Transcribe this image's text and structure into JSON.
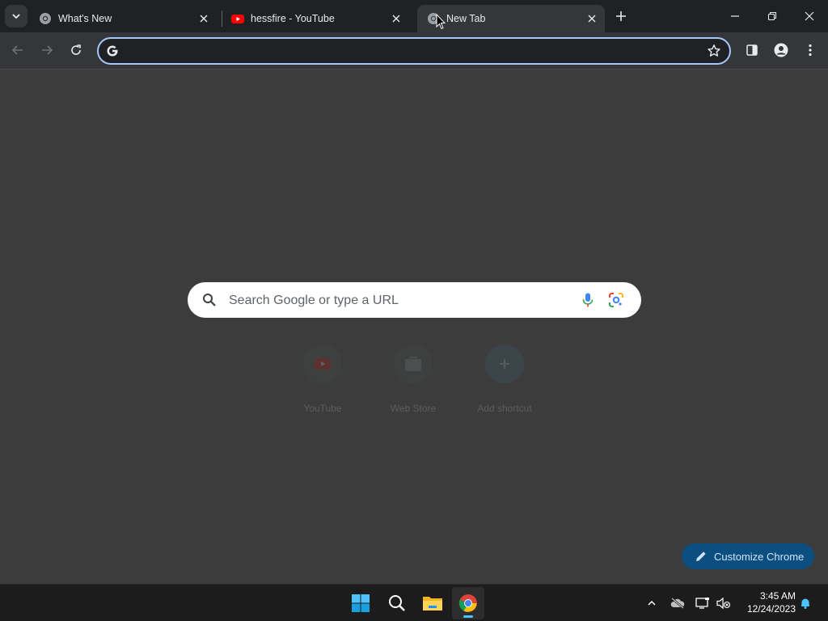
{
  "tabs": [
    {
      "title": "What's New",
      "favicon": "chrome-icon",
      "active": false
    },
    {
      "title": "hessfire - YouTube",
      "favicon": "youtube-icon",
      "active": false
    },
    {
      "title": "New Tab",
      "favicon": "chrome-icon",
      "active": true
    }
  ],
  "omnibox": {
    "value": "",
    "placeholder": ""
  },
  "search": {
    "placeholder": "Search Google or type a URL"
  },
  "shortcuts": [
    {
      "label": "YouTube",
      "icon": "youtube-icon"
    },
    {
      "label": "Web Store",
      "icon": "web-store-icon"
    },
    {
      "label": "Add shortcut",
      "icon": "plus-icon"
    }
  ],
  "customize": {
    "label": "Customize Chrome"
  },
  "clock": {
    "time": "3:45 AM",
    "date": "12/24/2023"
  },
  "colors": {
    "accent": "#a8c7fa",
    "customize_bg": "#0b4f80",
    "background": "#3c3c3c",
    "taskbar": "#1c1c1c"
  }
}
